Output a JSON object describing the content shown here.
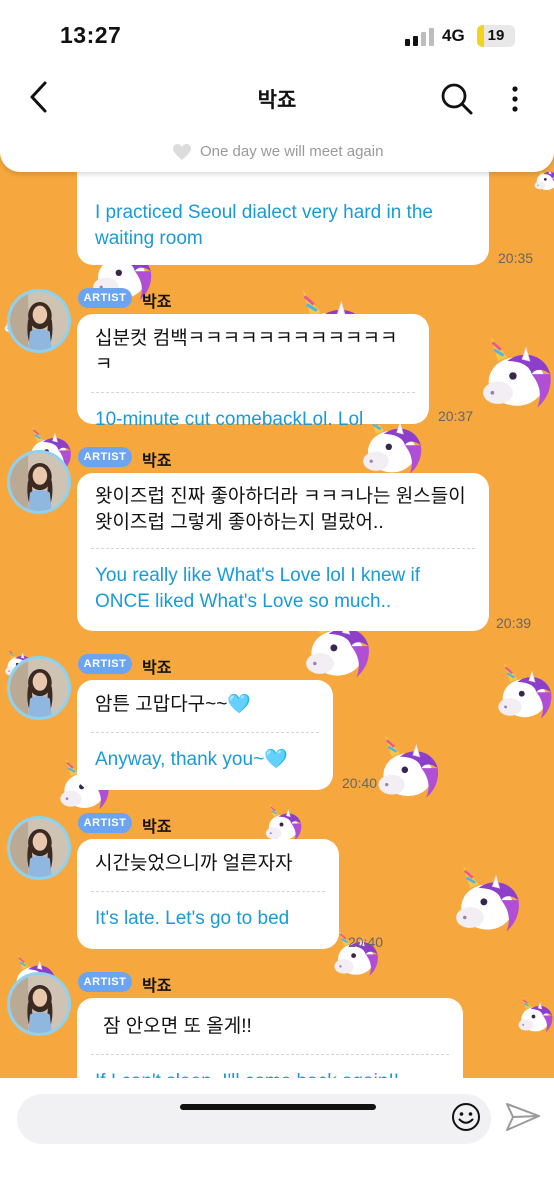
{
  "status": {
    "time": "13:27",
    "network": "4G",
    "battery": "19",
    "battery_level": 0.19,
    "battery_color": "#f4d31b"
  },
  "header": {
    "title": "박죠",
    "back_icon": "chevron-left-icon",
    "search_icon": "search-icon",
    "more_icon": "more-vertical-icon"
  },
  "notice": {
    "text": "One day we will meet again",
    "icon": "heart-icon"
  },
  "colors": {
    "background": "#f6a83e",
    "translation": "#1a9ad6",
    "badge": "#6ba5f2",
    "avatar_ring": "#8fd1f0"
  },
  "messages": [
    {
      "ko": "",
      "en": "I practiced Seoul dialect very hard in the waiting room",
      "time": "20:35"
    },
    {
      "badge": "ARTIST",
      "name": "박죠",
      "ko": "십분컷 컴백ㅋㅋㅋㅋㅋㅋㅋㅋㅋㅋㅋㅋㅋ",
      "en": "10-minute cut comebackLol. Lol",
      "time": "20:37"
    },
    {
      "badge": "ARTIST",
      "name": "박죠",
      "ko": "왓이즈럽 진짜 좋아하더라 ㅋㅋㅋ나는 원스들이 왓이즈럽 그렇게 좋아하는지 멀랐어..",
      "en": "You really like What's Love lol I knew if ONCE liked What's Love so much..",
      "time": "20:39"
    },
    {
      "badge": "ARTIST",
      "name": "박죠",
      "ko": "암튼 고맙다구~~🩵",
      "en": "Anyway, thank you~🩵",
      "time": "20:40"
    },
    {
      "badge": "ARTIST",
      "name": "박죠",
      "ko": "시간늦었으니까 얼른자자",
      "en": "It's late. Let's go to bed",
      "time": "20:40"
    },
    {
      "badge": "ARTIST",
      "name": "박죠",
      "ko": "잠 안오면 또 올게!!",
      "en": "If I can't sleep, I'll come back again!!",
      "time": ""
    }
  ],
  "input": {
    "emoji_icon": "smiley-icon",
    "send_icon": "send-icon"
  }
}
